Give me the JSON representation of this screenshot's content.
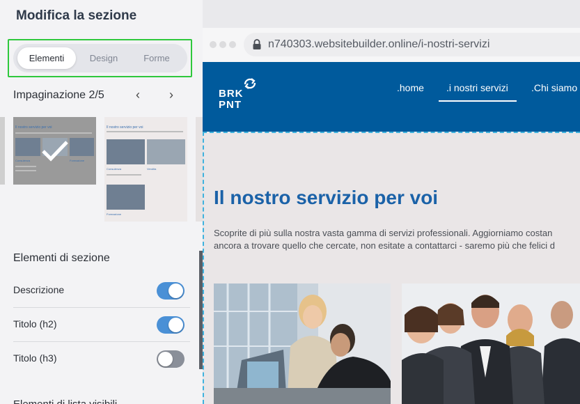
{
  "panel": {
    "title": "Modifica la sezione",
    "tabs": [
      {
        "label": "Elementi",
        "active": true
      },
      {
        "label": "Design",
        "active": false
      },
      {
        "label": "Forme",
        "active": false
      }
    ],
    "layout_label": "Impaginazione 2/5",
    "prev_arrow": "‹",
    "next_arrow": "›",
    "thumb_title": "Il nostro servizio per voi",
    "thumb_captions": [
      "Consulenza",
      "Vendita",
      "Formazione"
    ],
    "section_elements_title": "Elementi di sezione",
    "toggles": [
      {
        "label": "Descrizione",
        "on": true
      },
      {
        "label": "Titolo (h2)",
        "on": true
      },
      {
        "label": "Titolo (h3)",
        "on": false
      }
    ],
    "cut_title": "Elementi di lista visibili"
  },
  "browser": {
    "url": "n740303.websitebuilder.online/i-nostri-servizi"
  },
  "site": {
    "logo_line1": "BRK",
    "logo_line2": "PNT",
    "nav": [
      ".home",
      ".i nostri servizi",
      ".Chi siamo"
    ],
    "heading": "Il nostro servizio per voi",
    "description_line1": "Scoprite di più sulla nostra vasta gamma di servizi professionali. Aggiorniamo costan",
    "description_line2": "ancora a trovare quello che cercate, non esitate a contattarci - saremo più che felici d"
  },
  "colors": {
    "accent_blue": "#005a9c",
    "heading_blue": "#1b62a8",
    "toggle_on": "#4a90d6",
    "highlight_green": "#2ec83c",
    "section_dash": "#3fb2de"
  }
}
